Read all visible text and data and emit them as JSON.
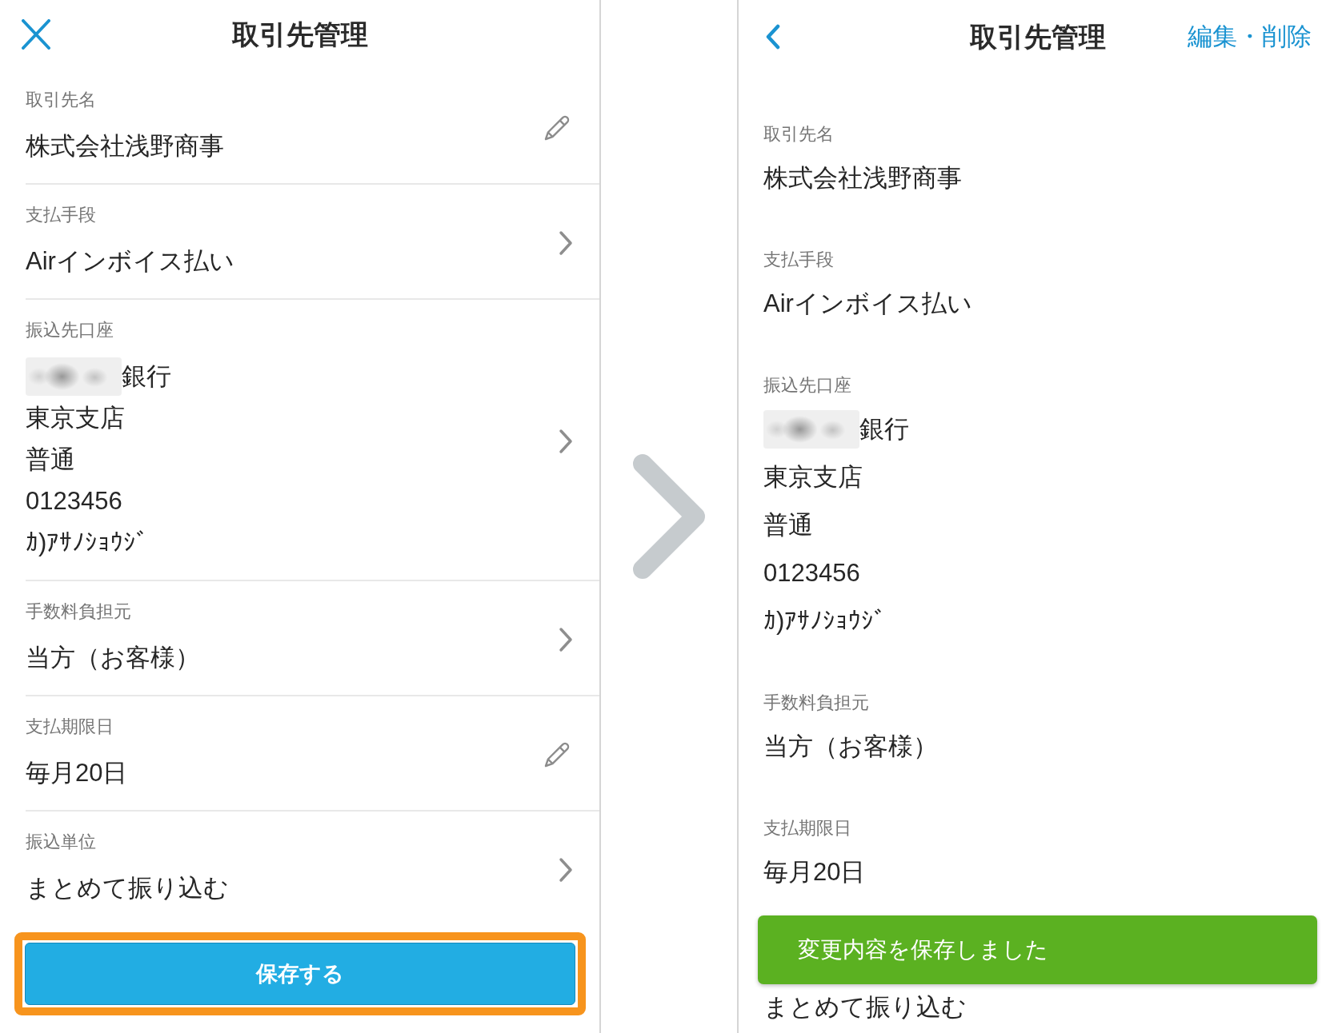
{
  "left_screen": {
    "title": "取引先管理",
    "fields": [
      {
        "kind": "edit",
        "label": "取引先名",
        "value": "株式会社浅野商事"
      },
      {
        "kind": "select",
        "label": "支払手段",
        "value": "Airインボイス払い"
      },
      {
        "kind": "select",
        "label": "振込先口座",
        "lines": [
          {
            "text": "銀行",
            "redacted": true
          },
          {
            "text": "東京支店",
            "redacted": false
          },
          {
            "text": "普通",
            "redacted": false
          },
          {
            "text": "0123456",
            "redacted": false
          },
          {
            "text": "ｶ)ｱｻﾉｼｮｳｼﾞ",
            "redacted": false
          }
        ]
      },
      {
        "kind": "select",
        "label": "手数料負担元",
        "value": "当方（お客様）"
      },
      {
        "kind": "edit",
        "label": "支払期限日",
        "value": "毎月20日"
      },
      {
        "kind": "select",
        "label": "振込単位",
        "value": "まとめて振り込む"
      }
    ],
    "save_button": {
      "label": "保存する",
      "highlighted": true
    }
  },
  "right_screen": {
    "title": "取引先管理",
    "action_link": "編集・削除",
    "fields": [
      {
        "label": "取引先名",
        "value": "株式会社浅野商事"
      },
      {
        "label": "支払手段",
        "value": "Airインボイス払い"
      },
      {
        "label": "振込先口座",
        "lines": [
          {
            "text": "銀行",
            "redacted": true
          },
          {
            "text": "東京支店",
            "redacted": false
          },
          {
            "text": "普通",
            "redacted": false
          },
          {
            "text": "0123456",
            "redacted": false
          },
          {
            "text": "ｶ)ｱｻﾉｼｮｳｼﾞ",
            "redacted": false
          }
        ]
      },
      {
        "label": "手数料負担元",
        "value": "当方（お客様）"
      },
      {
        "label": "支払期限日",
        "value": "毎月20日"
      },
      {
        "value": "まとめて振り込む"
      }
    ],
    "toast": {
      "message": "変更内容を保存しました"
    }
  }
}
